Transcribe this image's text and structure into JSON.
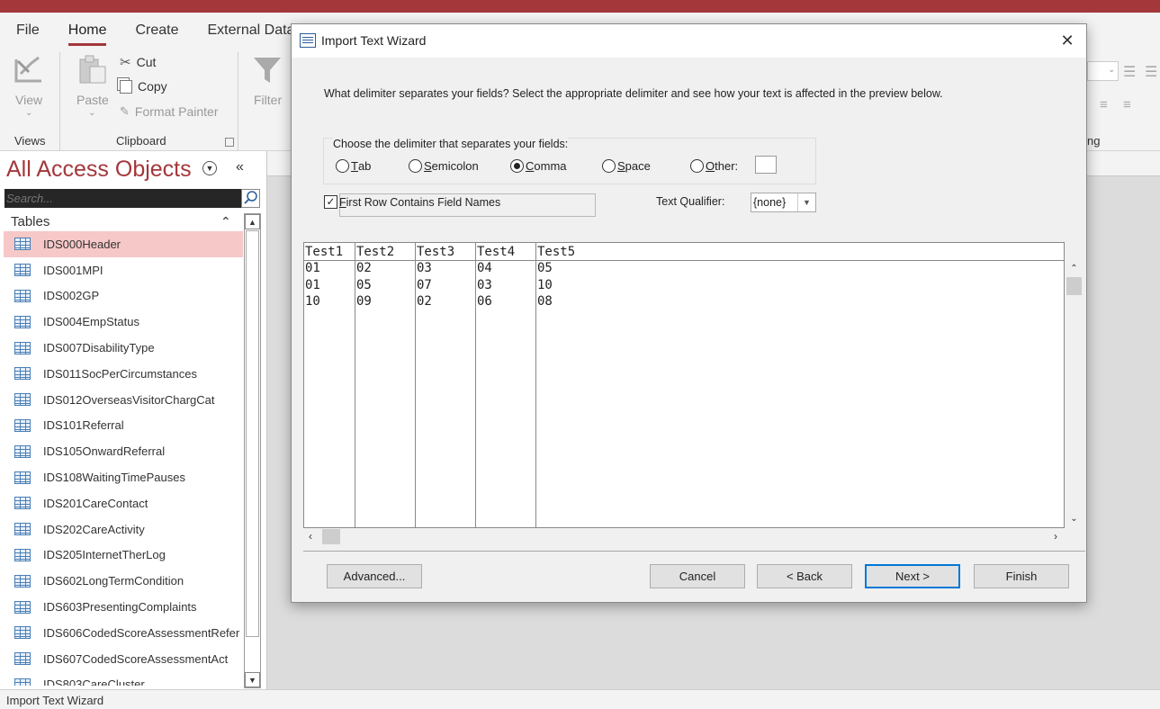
{
  "ribbon": {
    "tabs": [
      "File",
      "Home",
      "Create",
      "External Data"
    ],
    "active_tab": "Home",
    "views_group": {
      "view_label": "View",
      "group_label": "Views"
    },
    "clipboard_group": {
      "paste_label": "Paste",
      "cut_label": "Cut",
      "copy_label": "Copy",
      "format_painter_label": "Format Painter",
      "group_label": "Clipboard"
    },
    "filter_label": "Filter",
    "partial_group_label": "ng"
  },
  "nav": {
    "title": "All Access Objects",
    "search_placeholder": "Search...",
    "section_label": "Tables",
    "selected_index": 0,
    "tables": [
      "IDS000Header",
      "IDS001MPI",
      "IDS002GP",
      "IDS004EmpStatus",
      "IDS007DisabilityType",
      "IDS011SocPerCircumstances",
      "IDS012OverseasVisitorChargCat",
      "IDS101Referral",
      "IDS105OnwardReferral",
      "IDS108WaitingTimePauses",
      "IDS201CareContact",
      "IDS202CareActivity",
      "IDS205InternetTherLog",
      "IDS602LongTermCondition",
      "IDS603PresentingComplaints",
      "IDS606CodedScoreAssessmentRefer",
      "IDS607CodedScoreAssessmentAct",
      "IDS803CareCluster"
    ]
  },
  "statusbar": {
    "text": "Import Text Wizard"
  },
  "dialog": {
    "title": "Import Text Wizard",
    "prompt": "What delimiter separates your fields? Select the appropriate delimiter and see how your text is affected in the preview below.",
    "delimiter_group_label": "Choose the delimiter that separates your fields:",
    "delimiters": [
      {
        "key": "T",
        "rest": "ab",
        "checked": false
      },
      {
        "key": "S",
        "rest": "emicolon",
        "checked": false
      },
      {
        "key": "C",
        "rest": "omma",
        "checked": true
      },
      {
        "key": "S",
        "rest": "pace",
        "checked": false
      },
      {
        "key": "O",
        "rest": "ther:",
        "checked": false
      }
    ],
    "other_value": "",
    "first_row_checkbox": {
      "key": "F",
      "rest": "irst Row Contains Field Names",
      "checked": true
    },
    "text_qualifier_label": "Text Qualifier:",
    "text_qualifier_value": "{none}",
    "preview": {
      "headers": [
        "Test1",
        "Test2",
        "Test3",
        "Test4",
        "Test5"
      ],
      "rows": [
        [
          "01",
          "02",
          "03",
          "04",
          "05"
        ],
        [
          "01",
          "05",
          "07",
          "03",
          "10"
        ],
        [
          "10",
          "09",
          "02",
          "06",
          "08"
        ]
      ]
    },
    "buttons": {
      "advanced": "Advanced...",
      "cancel": "Cancel",
      "back": "< Back",
      "next": "Next >",
      "finish": "Finish"
    }
  }
}
